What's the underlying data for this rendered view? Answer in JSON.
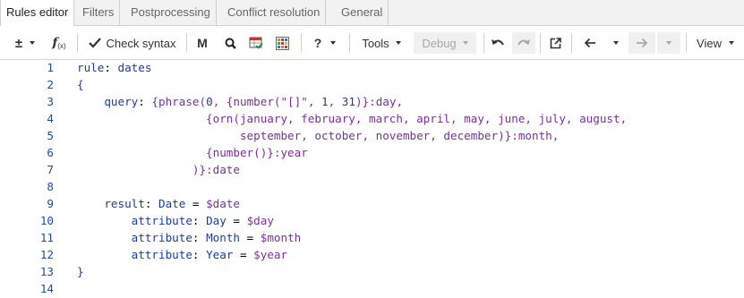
{
  "tabs": [
    {
      "label": "Rules editor",
      "active": true
    },
    {
      "label": "Filters"
    },
    {
      "label": "Postprocessing"
    },
    {
      "label": "Conflict resolution"
    },
    {
      "label": "General"
    }
  ],
  "toolbar": {
    "plus_minus": "±",
    "fx": "fx",
    "check_syntax": "Check syntax",
    "m_label": "M",
    "help": "?",
    "tools": "Tools",
    "debug": "Debug",
    "view": "View"
  },
  "editor": {
    "line_numbers": [
      "1",
      "2",
      "3",
      "4",
      "5",
      "6",
      "7",
      "8",
      "9",
      "10",
      "11",
      "12",
      "13",
      "14"
    ],
    "lines": [
      [
        {
          "c": "k",
          "t": "rule"
        },
        {
          "c": "t",
          "t": ": "
        },
        {
          "c": "k",
          "t": "dates"
        }
      ],
      [
        {
          "c": "k",
          "t": "{"
        }
      ],
      [
        {
          "c": "k",
          "t": "    query"
        },
        {
          "c": "t",
          "t": ": "
        },
        {
          "c": "v",
          "t": "{phrase("
        },
        {
          "c": "k",
          "t": "0"
        },
        {
          "c": "v",
          "t": ", {number(\"[]\", "
        },
        {
          "c": "k",
          "t": "1"
        },
        {
          "c": "v",
          "t": ", "
        },
        {
          "c": "k",
          "t": "31"
        },
        {
          "c": "v",
          "t": ")}:day,"
        }
      ],
      [
        {
          "c": "v",
          "t": "                   {orn(january, february, march, april, may, june, july, august,"
        }
      ],
      [
        {
          "c": "v",
          "t": "                        september, october, november, december)}:month,"
        }
      ],
      [
        {
          "c": "v",
          "t": "                   {number()}:year"
        }
      ],
      [
        {
          "c": "v",
          "t": "                 )}:date"
        }
      ],
      [],
      [
        {
          "c": "k",
          "t": "    result"
        },
        {
          "c": "t",
          "t": ": "
        },
        {
          "c": "k",
          "t": "Date"
        },
        {
          "c": "t",
          "t": " = "
        },
        {
          "c": "v",
          "t": "$date"
        }
      ],
      [
        {
          "c": "k",
          "t": "        attribute"
        },
        {
          "c": "t",
          "t": ": "
        },
        {
          "c": "k",
          "t": "Day"
        },
        {
          "c": "t",
          "t": " = "
        },
        {
          "c": "v",
          "t": "$day"
        }
      ],
      [
        {
          "c": "k",
          "t": "        attribute"
        },
        {
          "c": "t",
          "t": ": "
        },
        {
          "c": "k",
          "t": "Month"
        },
        {
          "c": "t",
          "t": " = "
        },
        {
          "c": "v",
          "t": "$month"
        }
      ],
      [
        {
          "c": "k",
          "t": "        attribute"
        },
        {
          "c": "t",
          "t": ": "
        },
        {
          "c": "k",
          "t": "Year"
        },
        {
          "c": "t",
          "t": " = "
        },
        {
          "c": "v",
          "t": "$year"
        }
      ],
      [
        {
          "c": "k",
          "t": "}"
        }
      ],
      []
    ]
  },
  "icons": {
    "check": "check-icon",
    "zoom": "zoom-icon",
    "table_check": "table-check-icon",
    "grid": "grid-icon",
    "undo": "undo-icon",
    "redo": "redo-icon",
    "open_external": "open-external-icon",
    "back": "arrow-left-icon",
    "forward": "arrow-right-icon"
  },
  "colors": {
    "line_number": "#1a4fa0",
    "keyword": "#1a3d99",
    "value": "#7a2f9a"
  }
}
